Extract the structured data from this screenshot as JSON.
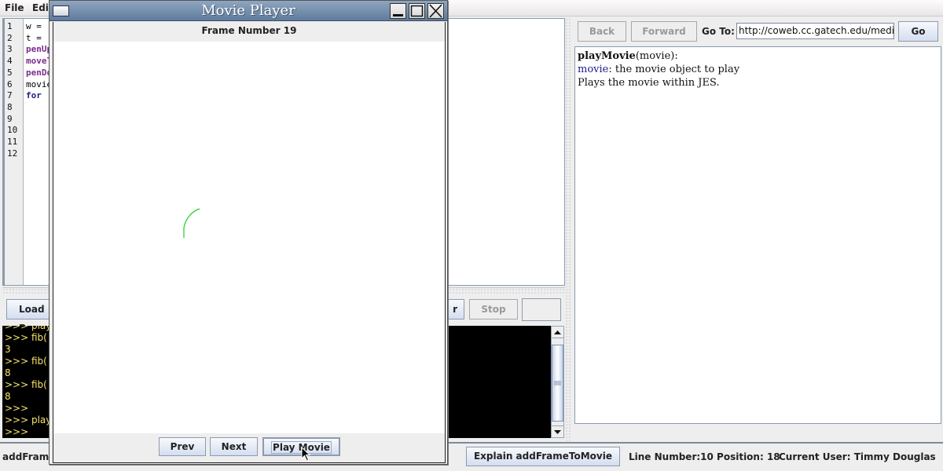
{
  "menubar": {
    "items": [
      {
        "label": "File"
      },
      {
        "label": "Edit"
      }
    ]
  },
  "editor": {
    "line_numbers": [
      "1",
      "2",
      "3",
      "4",
      "5",
      "6",
      "7",
      "8",
      "9",
      "10",
      "11",
      "12"
    ],
    "visible_code": [
      {
        "text": "w = ",
        "style": "plain"
      },
      {
        "text": "t = ",
        "style": "plain"
      },
      {
        "text": "penUp",
        "style": "purple"
      },
      {
        "text": "moveT",
        "style": "purple"
      },
      {
        "text": "penDo",
        "style": "purple"
      },
      {
        "text": "movie",
        "style": "plain"
      },
      {
        "text": "for ",
        "style": "blue"
      }
    ]
  },
  "toolbar": {
    "load_label": "Load Program",
    "stop_label": "Stop",
    "partial_right_label": "r"
  },
  "console": {
    "lines": [
      ">>> play",
      ">>> fib(",
      "3",
      ">>> fib(",
      "8",
      ">>> fib(",
      "8",
      ">>>",
      ">>> play",
      ">>>"
    ]
  },
  "help": {
    "back_label": "Back",
    "forward_label": "Forward",
    "goto_label": "Go To:",
    "url_value": "http://coweb.cc.gatech.edu/medi",
    "go_label": "Go",
    "function_name": "playMovie",
    "signature_rest": "(movie):",
    "param_name": "movie",
    "param_desc": ": the movie object to play",
    "description": "Plays the movie within JES."
  },
  "statusbar": {
    "left_text": "addFrameToMovie",
    "explain_label": "Explain addFrameToMovie",
    "line_position": "Line Number:10 Position: 18",
    "current_user": "Current User: Timmy Douglas"
  },
  "movie_player": {
    "title": "Movie Player",
    "frame_label": "Frame Number 19",
    "prev_label": "Prev",
    "next_label": "Next",
    "play_label": "Play Movie",
    "drawing_color": "#22cc22"
  }
}
